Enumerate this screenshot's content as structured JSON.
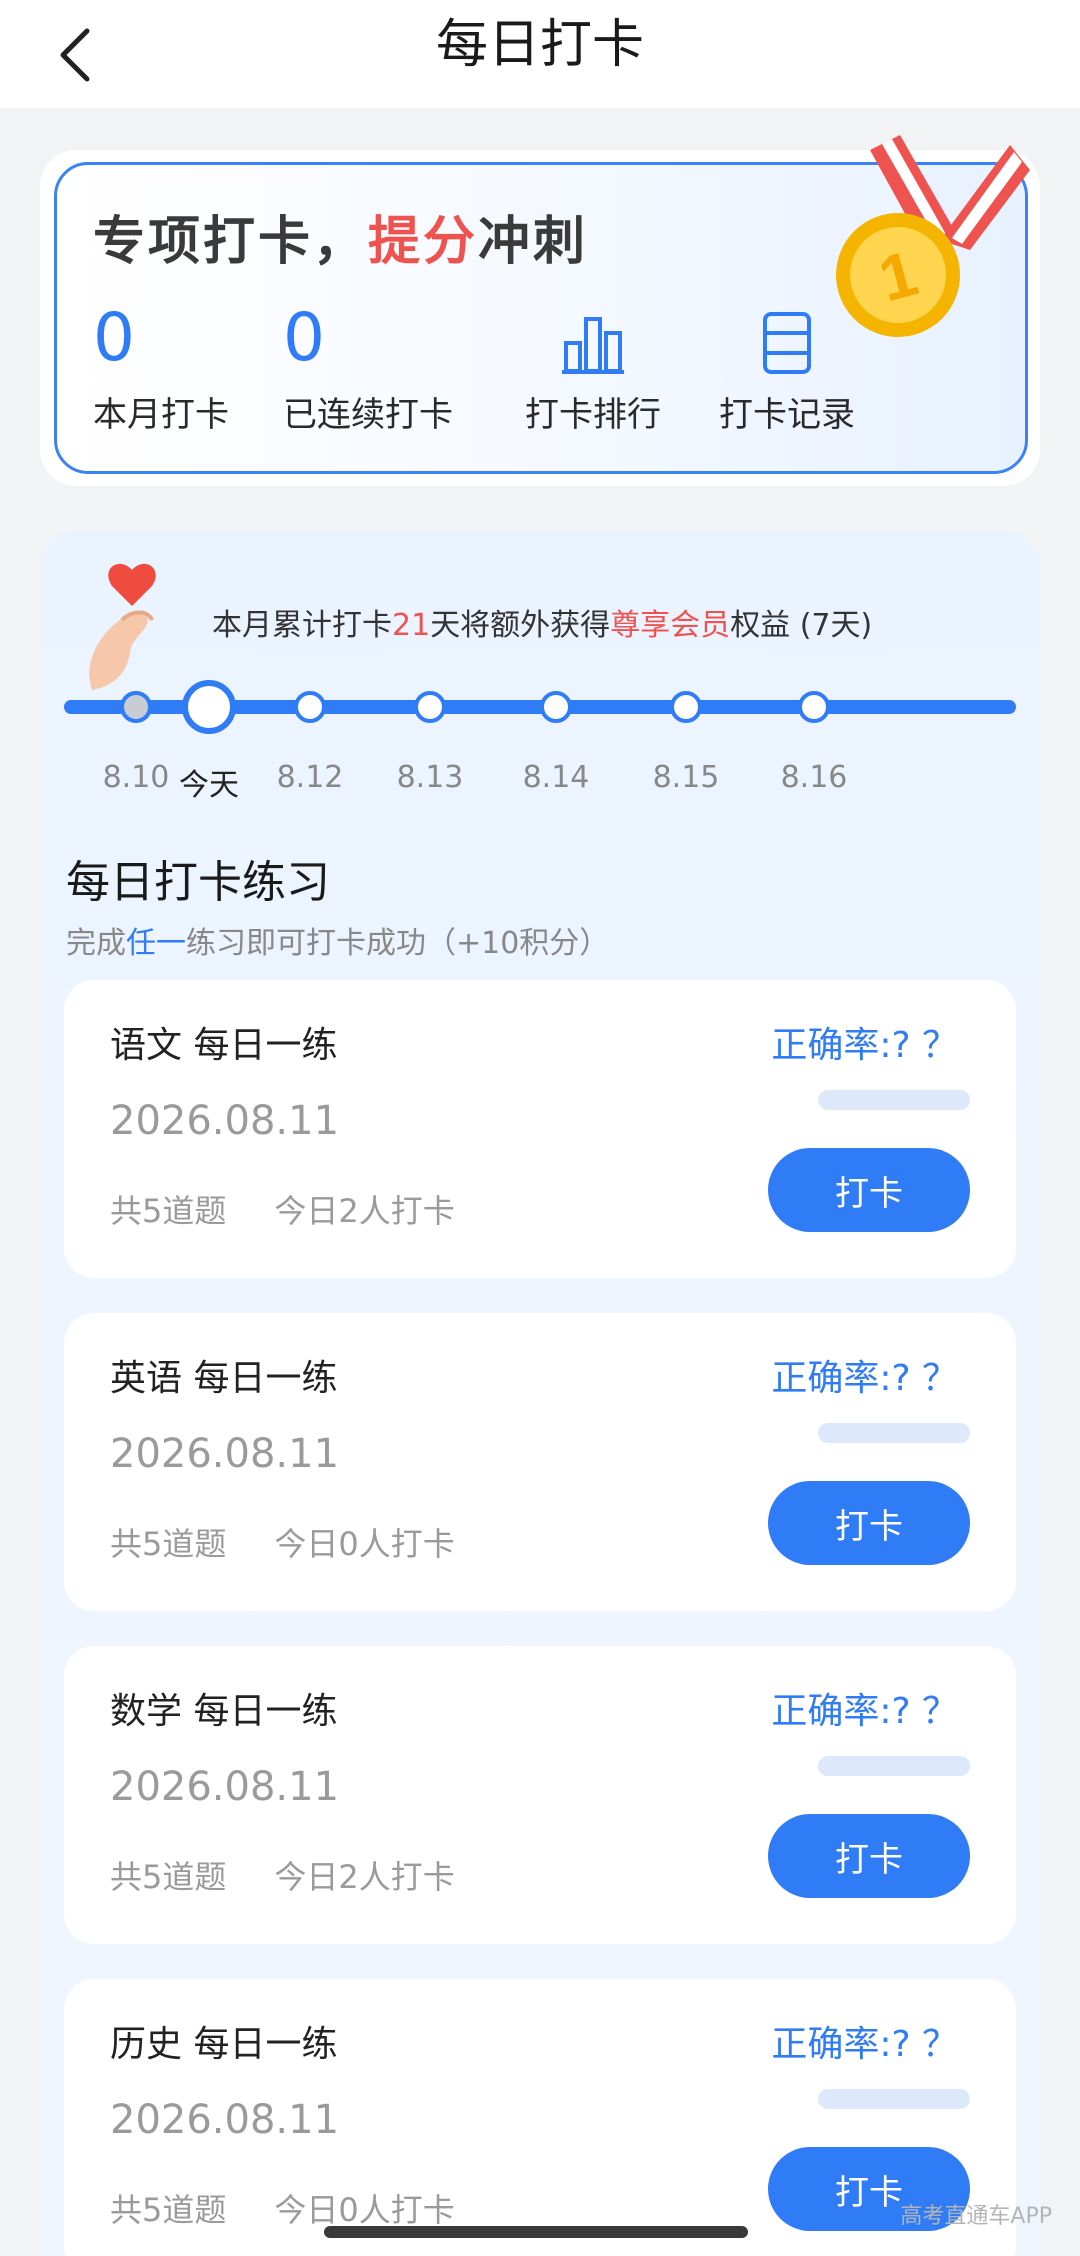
{
  "header": {
    "title": "每日打卡"
  },
  "banner": {
    "title_part1": "专项打卡，",
    "title_highlight": "提分",
    "title_part2": "冲刺",
    "stats": [
      {
        "value": "0",
        "label": "本月打卡"
      },
      {
        "value": "0",
        "label": "已连续打卡"
      }
    ],
    "tools": [
      {
        "icon": "bar-chart-icon",
        "label": "打卡排行"
      },
      {
        "icon": "list-icon",
        "label": "打卡记录"
      }
    ]
  },
  "promo": {
    "pre": "本月累计打卡",
    "days": "21",
    "mid": "天将额外获得",
    "benefit": "尊享会员",
    "post": "权益 (7天)"
  },
  "timeline": {
    "dates": [
      "8.10",
      "今天",
      "8.12",
      "8.13",
      "8.14",
      "8.15",
      "8.16"
    ],
    "current_index": 1
  },
  "practice": {
    "title": "每日打卡练习",
    "sub_pre": "完成",
    "sub_hl": "任一",
    "sub_post": "练习即可打卡成功（+10积分）"
  },
  "exercises": [
    {
      "title": "语文 每日一练",
      "date": "2026.08.11",
      "count": "共5道题",
      "people": "今日2人打卡",
      "accuracy": "正确率:? ？",
      "button": "打卡"
    },
    {
      "title": "英语 每日一练",
      "date": "2026.08.11",
      "count": "共5道题",
      "people": "今日0人打卡",
      "accuracy": "正确率:? ？",
      "button": "打卡"
    },
    {
      "title": "数学 每日一练",
      "date": "2026.08.11",
      "count": "共5道题",
      "people": "今日2人打卡",
      "accuracy": "正确率:? ？",
      "button": "打卡"
    },
    {
      "title": "历史 每日一练",
      "date": "2026.08.11",
      "count": "共5道题",
      "people": "今日0人打卡",
      "accuracy": "正确率:? ？",
      "button": "打卡"
    }
  ],
  "watermark": "高考直通车APP",
  "colors": {
    "accent": "#2f7cf6",
    "highlight": "#ef5350"
  }
}
